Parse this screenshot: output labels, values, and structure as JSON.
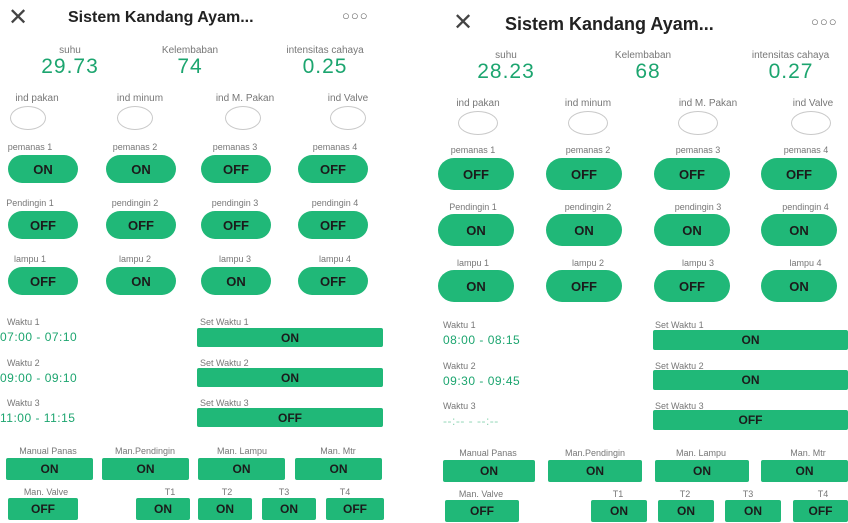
{
  "left": {
    "app_title": "Sistem  Kandang Ayam...",
    "menu_icon": "more-dots-icon",
    "sensors": [
      {
        "label": "suhu",
        "value": "29.73"
      },
      {
        "label": "Kelembaban",
        "value": "74"
      },
      {
        "label": "intensitas cahaya",
        "value": "0.25"
      }
    ],
    "indicators": [
      "ind pakan",
      "ind minum",
      "ind M. Pakan",
      "ind Valve"
    ],
    "pemanas": {
      "labels": [
        "pemanas 1",
        "pemanas 2",
        "pemanas 3",
        "pemanas 4"
      ],
      "states": [
        "ON",
        "ON",
        "OFF",
        "OFF"
      ]
    },
    "pendingin": {
      "labels": [
        "Pendingin 1",
        "pendingin 2",
        "pendingin 3",
        "pendingin 4"
      ],
      "states": [
        "OFF",
        "OFF",
        "OFF",
        "OFF"
      ]
    },
    "lampu": {
      "labels": [
        "lampu 1",
        "lampu 2",
        "lampu 3",
        "lampu 4"
      ],
      "states": [
        "OFF",
        "ON",
        "ON",
        "OFF"
      ]
    },
    "waktu": [
      {
        "label": "Waktu 1",
        "value": "07:00 - 07:10",
        "set_label": "Set Waktu 1",
        "set_state": "ON"
      },
      {
        "label": "Waktu 2",
        "value": "09:00 - 09:10",
        "set_label": "Set Waktu 2",
        "set_state": "ON"
      },
      {
        "label": "Waktu 3",
        "value": "11:00 - 11:15",
        "set_label": "Set Waktu 3",
        "set_state": "OFF"
      }
    ],
    "manual": {
      "labels": [
        "Manual Panas",
        "Man.Pendingin",
        "Man. Lampu",
        "Man. Mtr"
      ],
      "states": [
        "ON",
        "ON",
        "ON",
        "ON"
      ]
    },
    "bottom": {
      "labels": [
        "Man. Valve",
        "T1",
        "T2",
        "T3",
        "T4"
      ],
      "states": [
        "OFF",
        "ON",
        "ON",
        "ON",
        "OFF"
      ]
    }
  },
  "right": {
    "app_title": "Sistem  Kandang Ayam...",
    "menu_icon": "more-dots-icon",
    "sensors": [
      {
        "label": "suhu",
        "value": "28.23"
      },
      {
        "label": "Kelembaban",
        "value": "68"
      },
      {
        "label": "intensitas cahaya",
        "value": "0.27"
      }
    ],
    "indicators": [
      "ind pakan",
      "ind minum",
      "ind M. Pakan",
      "ind Valve"
    ],
    "pemanas": {
      "labels": [
        "pemanas 1",
        "pemanas 2",
        "pemanas 3",
        "pemanas 4"
      ],
      "states": [
        "OFF",
        "OFF",
        "OFF",
        "OFF"
      ]
    },
    "pendingin": {
      "labels": [
        "Pendingin 1",
        "pendingin 2",
        "pendingin 3",
        "pendingin 4"
      ],
      "states": [
        "ON",
        "ON",
        "ON",
        "ON"
      ]
    },
    "lampu": {
      "labels": [
        "lampu 1",
        "lampu 2",
        "lampu 3",
        "lampu 4"
      ],
      "states": [
        "ON",
        "OFF",
        "OFF",
        "ON"
      ]
    },
    "waktu": [
      {
        "label": "Waktu 1",
        "value": "08:00 - 08:15",
        "set_label": "Set Waktu 1",
        "set_state": "ON"
      },
      {
        "label": "Waktu 2",
        "value": "09:30 - 09:45",
        "set_label": "Set Waktu 2",
        "set_state": "ON"
      },
      {
        "label": "Waktu 3",
        "value": "--:-- - --:--",
        "set_label": "Set Waktu 3",
        "set_state": "OFF"
      }
    ],
    "manual": {
      "labels": [
        "Manual Panas",
        "Man.Pendingin",
        "Man. Lampu",
        "Man. Mtr"
      ],
      "states": [
        "ON",
        "ON",
        "ON",
        "ON"
      ]
    },
    "bottom": {
      "labels": [
        "Man. Valve",
        "T1",
        "T2",
        "T3",
        "T4"
      ],
      "states": [
        "OFF",
        "ON",
        "ON",
        "ON",
        "OFF"
      ]
    }
  },
  "colors": {
    "accent": "#20b878",
    "value_text": "#1ca56f",
    "label_text": "#777777"
  }
}
